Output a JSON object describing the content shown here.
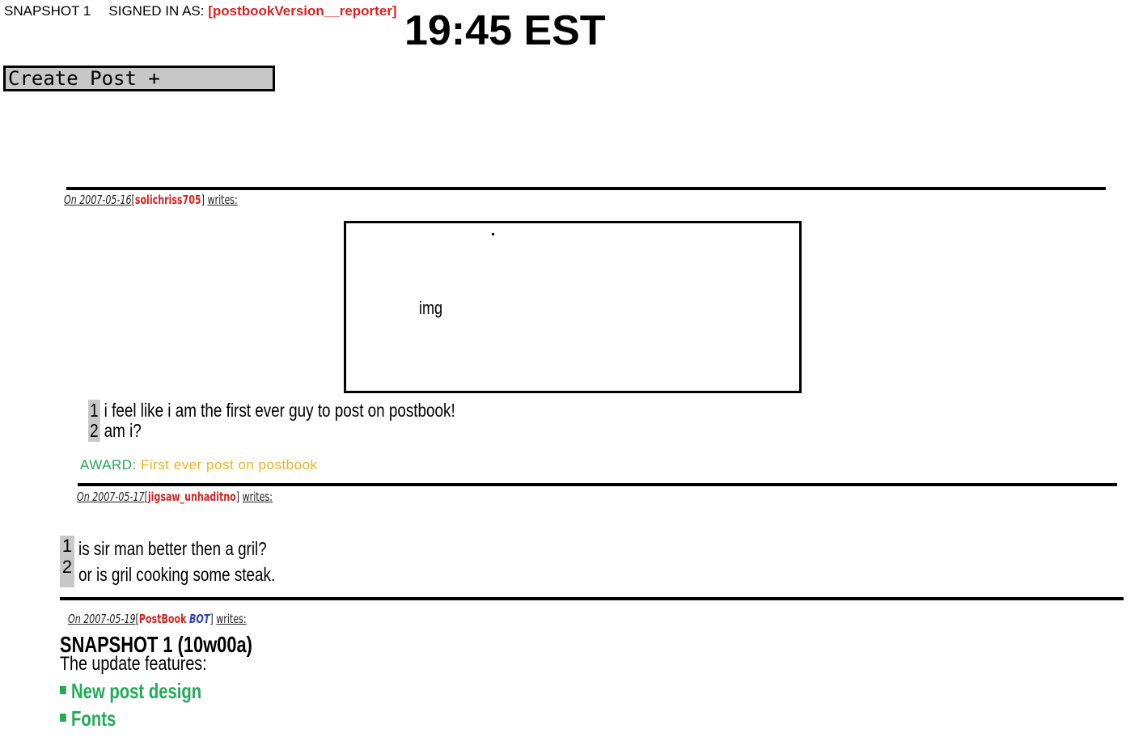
{
  "header": {
    "snapshot_label": "SNAPSHOT 1",
    "signed_in_prefix": "SIGNED IN AS:",
    "username": "[postbookVersion__reporter]",
    "clock": "19:45 EST",
    "create_post_label": "Create Post +"
  },
  "posts": [
    {
      "date": "On 2007-05-16",
      "author_open": "[",
      "author": "solichriss705",
      "author_close": "]",
      "writes": "writes:",
      "image_placeholder": "img",
      "lines": [
        {
          "num": "1",
          "text": "i feel like i am the first ever guy to post on postbook!"
        },
        {
          "num": "2",
          "text": "am i?"
        }
      ],
      "award_label": "AWARD:",
      "award_value": "First ever post on postbook"
    },
    {
      "date": "On 2007-05-17",
      "author_open": "[",
      "author": "jigsaw_unhaditno",
      "author_close": "]",
      "writes": "writes:",
      "line_numbers": [
        "1",
        "2"
      ],
      "lines": [
        {
          "text": "is sir man better then a gril?"
        },
        {
          "text": "or is gril cooking some steak."
        }
      ]
    },
    {
      "date": "On 2007-05-19",
      "author_open": "[",
      "author": "PostBook",
      "author_bot": "BOT",
      "author_close": "]",
      "writes": "writes:",
      "title": "SNAPSHOT 1 (10w00a)",
      "subtitle": "The update features:",
      "features": [
        "New post design",
        "Fonts"
      ]
    }
  ],
  "colors": {
    "username": "#e02020",
    "author": "#e02020",
    "bot": "#2f3fc0",
    "award_label": "#22aa55",
    "award_value": "#f0b020",
    "feature": "#22aa55",
    "line_number_bg": "#c8c8c8"
  }
}
